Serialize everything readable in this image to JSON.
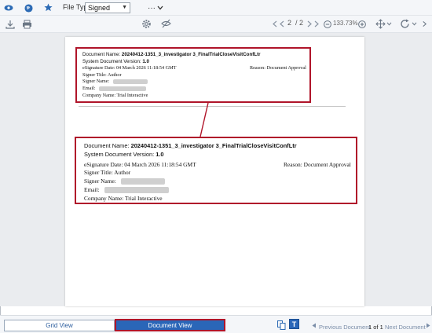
{
  "toolbar": {
    "file_type_label": "File Type:",
    "file_type_value": "Signed",
    "page_current": "2",
    "page_total": "/ 2",
    "zoom": "133.73%"
  },
  "signature_small": {
    "doc_name_label": "Document Name:",
    "doc_name_value": "20240412-1351_3_investigator 3_FinalTrialCloseVisitConfLtr",
    "version_label": "System Document Version:",
    "version_value": "1.0",
    "esign_date": "eSignature Date:  04 March 2026 11:18:54 GMT",
    "reason": "Reason:  Document Approval",
    "signer_title": "Signer Title:  Author",
    "signer_name": "Signer Name:",
    "email": "Email:",
    "company": "Company Name:  Trial Interactive"
  },
  "signature_large": {
    "doc_name_label": "Document Name:",
    "doc_name_value": "20240412-1351_3_investigator 3_FinalTrialCloseVisitConfLtr",
    "version_label": "System Document Version:",
    "version_value": "1.0",
    "esign_date": "eSignature Date:  04 March 2026 11:18:54 GMT",
    "reason": "Reason:  Document Approval",
    "signer_title": "Signer Title:  Author",
    "signer_name": "Signer Name:",
    "email": "Email:",
    "company": "Company Name:  Trial Interactive"
  },
  "bottom": {
    "grid_view": "Grid View",
    "document_view": "Document View",
    "previous": "Previous Document",
    "position": "1 of 1",
    "next": "Next Document"
  },
  "colors": {
    "accent": "#2a66b8",
    "highlight": "#b0152a"
  },
  "icons": [
    "logo-icon",
    "globe-icon",
    "star-icon",
    "download-icon",
    "print-icon",
    "settings-gear-icon",
    "hide-icon",
    "first-page-icon",
    "prev-page-icon",
    "next-page-icon",
    "last-page-icon",
    "zoom-out-icon",
    "zoom-in-icon",
    "fit-icon",
    "rotate-icon",
    "thumbnail-icon",
    "text-icon"
  ]
}
